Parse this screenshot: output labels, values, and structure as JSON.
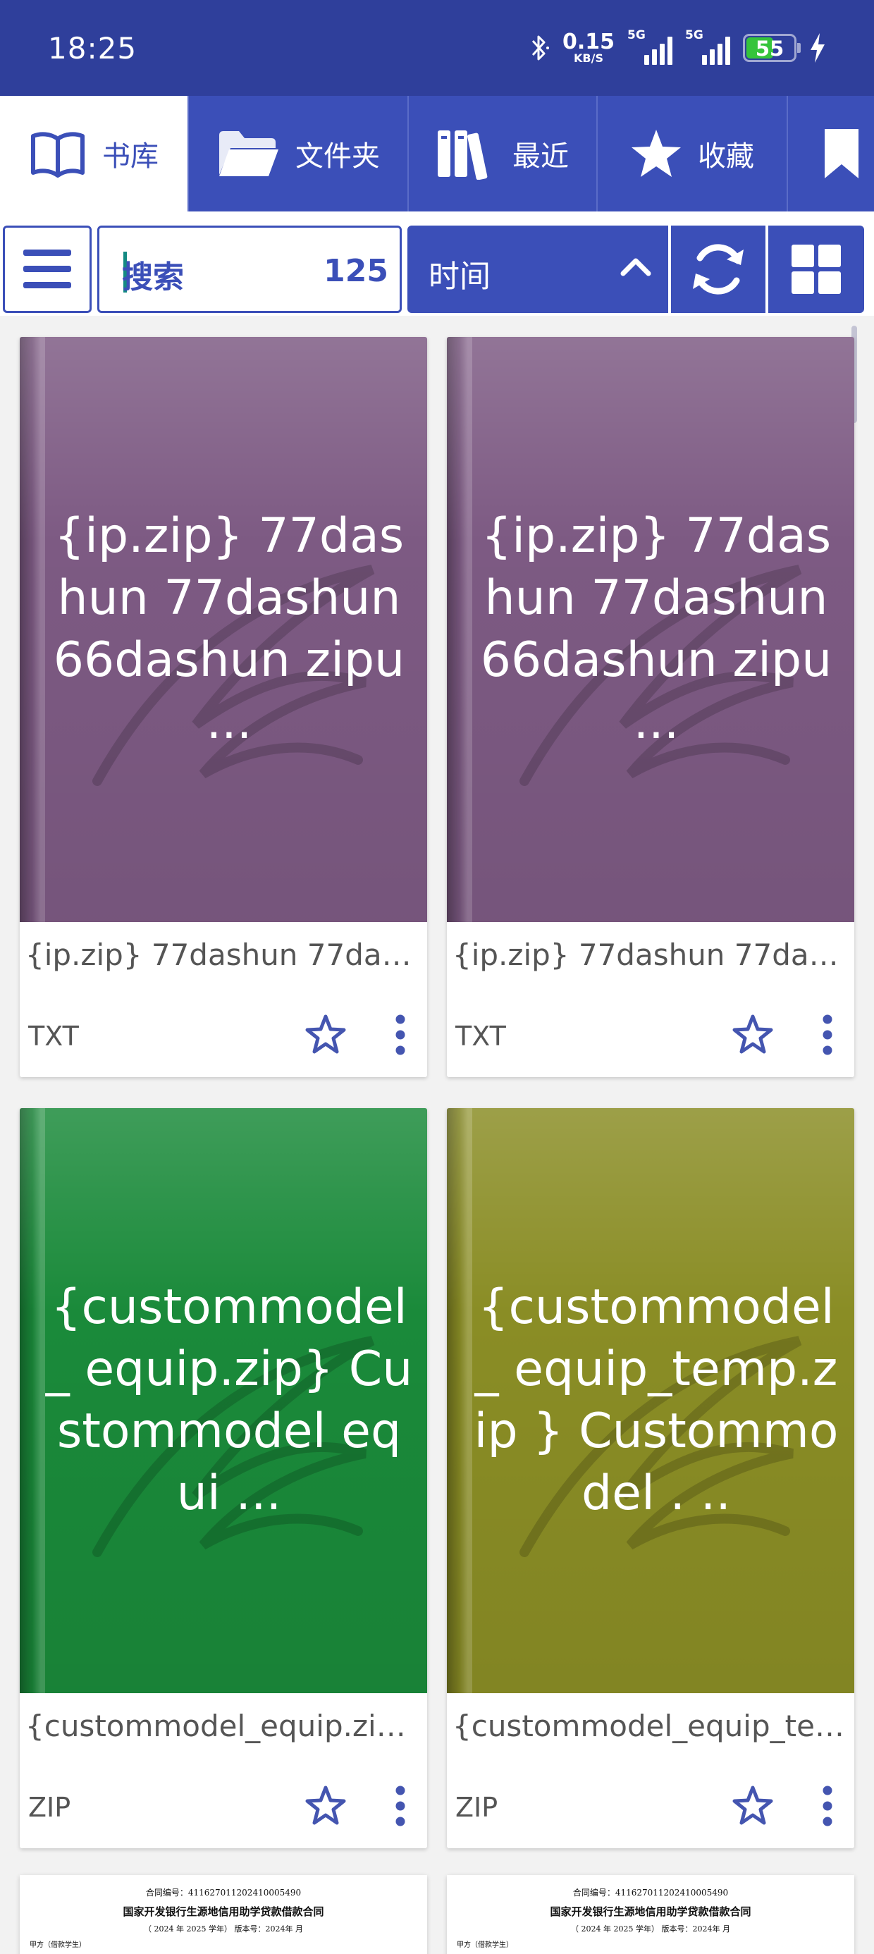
{
  "status_bar": {
    "time": "18:25",
    "net_speed_value": "0.15",
    "net_speed_unit": "KB/S",
    "sim1_tag": "5G",
    "sim2_tag": "5G",
    "battery": "55"
  },
  "tabs": [
    {
      "label": "书库",
      "icon": "book-open-icon",
      "active": true
    },
    {
      "label": "文件夹",
      "icon": "folder-icon",
      "active": false
    },
    {
      "label": "最近",
      "icon": "books-icon",
      "active": false
    },
    {
      "label": "收藏",
      "icon": "star-icon",
      "active": false
    },
    {
      "label": "",
      "icon": "bookmark-icon",
      "active": false
    }
  ],
  "toolbar": {
    "search_placeholder": "搜索",
    "count": "125",
    "sort_label": "时间"
  },
  "books": [
    {
      "cover_text": "{ip.zip} 77dashun 77dashun 66dashun zipu ...",
      "cover_color": "#7d5a83",
      "name": "{ip.zip} 77dashun 77dashun 66dashun zipu",
      "type": "TXT"
    },
    {
      "cover_text": "{ip.zip} 77dashun 77dashun 66dashun zipu ...",
      "cover_color": "#7d5a83",
      "name": "{ip.zip} 77dashun 77dashun 66dashun zipu",
      "type": "TXT"
    },
    {
      "cover_text": "{custommodel_ equip.zip} Custommodel equi ...",
      "cover_color": "#1a8a3a",
      "name": "{custommodel_equip.zip} Custommodel equip",
      "type": "ZIP"
    },
    {
      "cover_text": "{custommodel_ equip_temp.zip } Custommodel . ..",
      "cover_color": "#8a8d25",
      "name": "{custommodel_equip_temp.zip} Custommodel",
      "type": "ZIP"
    }
  ],
  "docs": [
    {
      "contract_no": "合同编号：411627011202410005490",
      "title": "国家开发银行生源地信用助学贷款借款合同",
      "meta": "（ 2024 年 2025 学年）      版本号：2024年   月",
      "extra": "甲方（借款学生）"
    },
    {
      "contract_no": "合同编号：411627011202410005490",
      "title": "国家开发银行生源地信用助学贷款借款合同",
      "meta": "（ 2024 年 2025 学年）      版本号：2024年   月",
      "extra": "甲方（借款学生）"
    }
  ],
  "colors": {
    "primary": "#3b4fb8",
    "statusbar": "#2f3f9b",
    "battery_green": "#35c43b",
    "icon_blue": "#4455b0"
  }
}
